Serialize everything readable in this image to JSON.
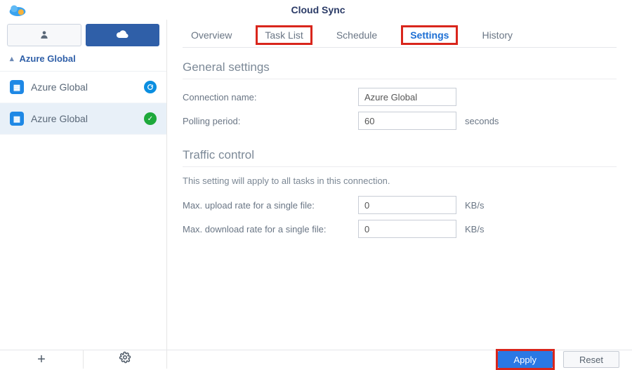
{
  "app_title": "Cloud Sync",
  "sidebar": {
    "section_label": "Azure Global",
    "items": [
      {
        "label": "Azure Global",
        "status": "sync"
      },
      {
        "label": "Azure Global",
        "status": "ok"
      }
    ]
  },
  "tabs": {
    "overview": "Overview",
    "tasklist": "Task List",
    "schedule": "Schedule",
    "settings": "Settings",
    "history": "History"
  },
  "general": {
    "title": "General settings",
    "connection_name_label": "Connection name:",
    "connection_name_value": "Azure Global",
    "polling_label": "Polling period:",
    "polling_value": "60",
    "polling_unit": "seconds"
  },
  "traffic": {
    "title": "Traffic control",
    "description": "This setting will apply to all tasks in this connection.",
    "upload_label": "Max. upload rate for a single file:",
    "upload_value": "0",
    "download_label": "Max. download rate for a single file:",
    "download_value": "0",
    "rate_unit": "KB/s"
  },
  "buttons": {
    "apply": "Apply",
    "reset": "Reset"
  }
}
